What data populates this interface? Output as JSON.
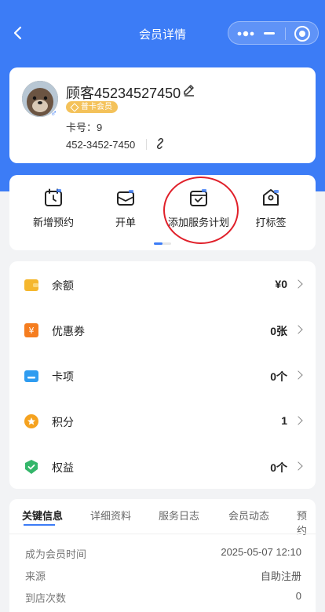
{
  "nav": {
    "title": "会员详情"
  },
  "profile": {
    "name": "顾客45234527450",
    "badge": "普卡会员",
    "card_no": "卡号：9",
    "phone": "452-3452-7450",
    "gender_symbol": "♂"
  },
  "actions": [
    {
      "label": "新增预约",
      "icon": "calendar-add-icon"
    },
    {
      "label": "开单",
      "icon": "order-box-icon"
    },
    {
      "label": "添加服务计划",
      "icon": "service-plan-icon"
    },
    {
      "label": "打标签",
      "icon": "tag-icon"
    }
  ],
  "assets": [
    {
      "label": "余额",
      "value": "¥0",
      "icon": "wallet-icon",
      "color": "#f5b72e"
    },
    {
      "label": "优惠券",
      "value": "0张",
      "icon": "coupon-icon",
      "color": "#f57d1f"
    },
    {
      "label": "卡项",
      "value": "0个",
      "icon": "card-icon",
      "color": "#2f9cf0"
    },
    {
      "label": "积分",
      "value": "1",
      "icon": "points-icon",
      "color": "#f5a21f"
    },
    {
      "label": "权益",
      "value": "0个",
      "icon": "shield-icon",
      "color": "#34b66a"
    }
  ],
  "tabs": [
    "关键信息",
    "详细资料",
    "服务日志",
    "会员动态",
    "预约"
  ],
  "key_info": [
    {
      "label": "成为会员时间",
      "value": "2025-05-07 12:10"
    },
    {
      "label": "来源",
      "value": "自助注册"
    },
    {
      "label": "到店次数",
      "value": "0"
    }
  ],
  "colors": {
    "primary": "#3c7cf6",
    "highlight": "#e0202a"
  }
}
